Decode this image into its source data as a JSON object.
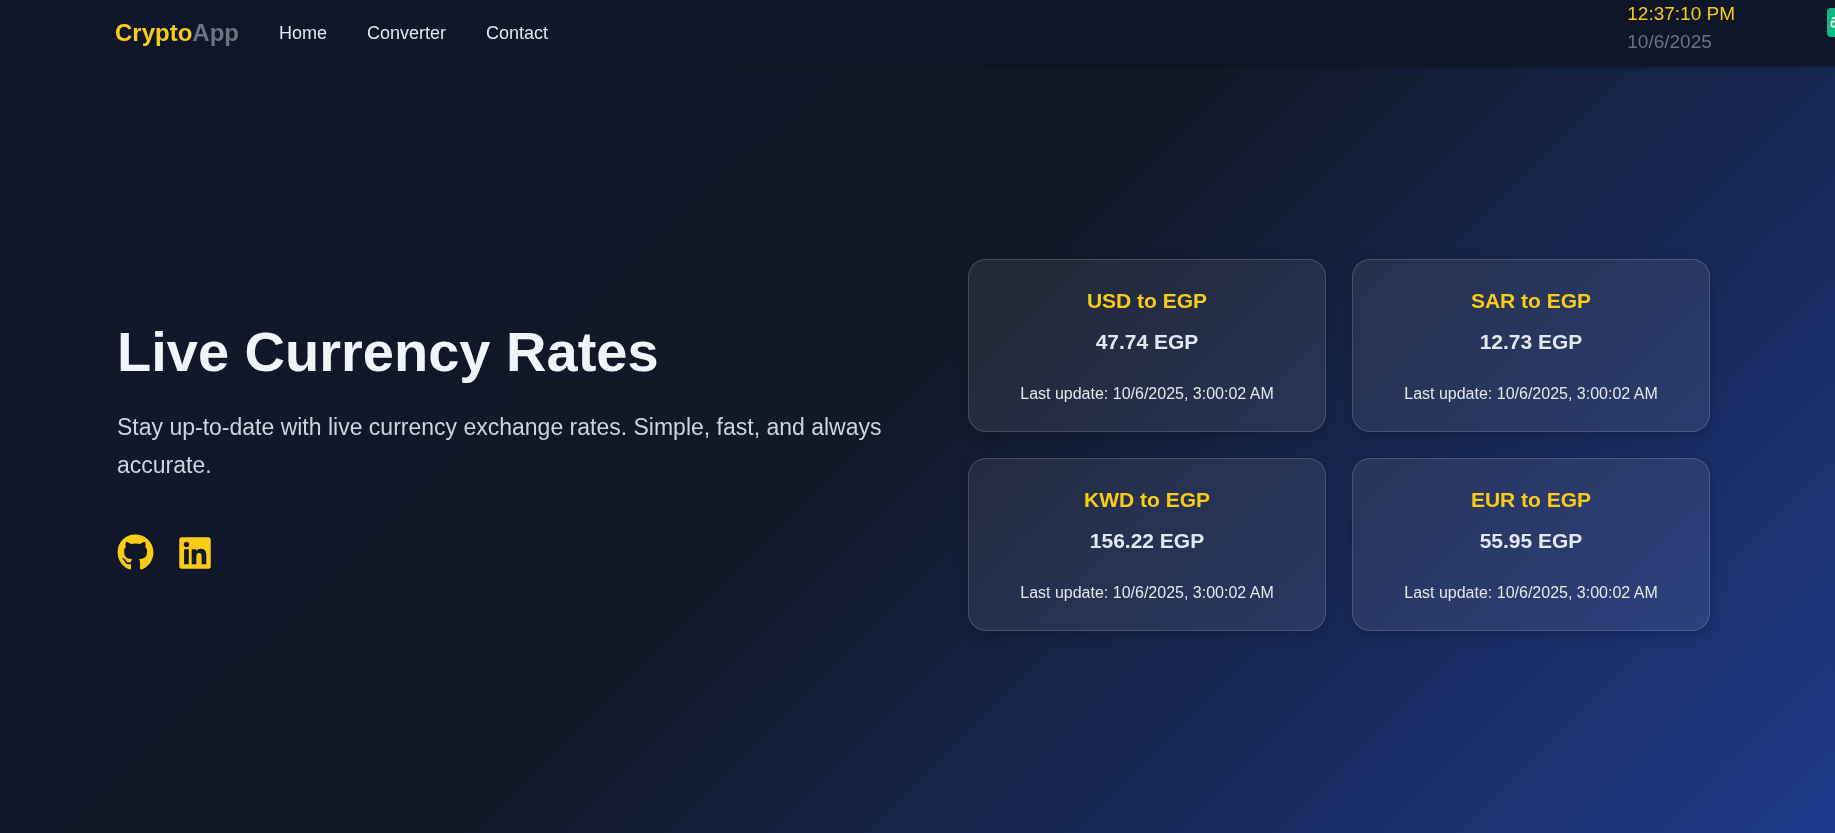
{
  "nav": {
    "brand": {
      "primary": "Crypto",
      "secondary": "App"
    },
    "links": [
      "Home",
      "Converter",
      "Contact"
    ],
    "clock": {
      "time": "12:37:10 PM",
      "date": "10/6/2025"
    }
  },
  "hero": {
    "title": "Live Currency Rates",
    "subtitle": "Stay up-to-date with live currency exchange rates. Simple, fast, and always accurate.",
    "social": [
      {
        "kind": "github"
      },
      {
        "kind": "linkedin"
      }
    ]
  },
  "rates": [
    {
      "pair": "USD to EGP",
      "value": "47.74 EGP",
      "updated": "Last update: 10/6/2025, 3:00:02 AM"
    },
    {
      "pair": "SAR to EGP",
      "value": "12.73 EGP",
      "updated": "Last update: 10/6/2025, 3:00:02 AM"
    },
    {
      "pair": "KWD to EGP",
      "value": "156.22 EGP",
      "updated": "Last update: 10/6/2025, 3:00:02 AM"
    },
    {
      "pair": "EUR to EGP",
      "value": "55.95 EGP",
      "updated": "Last update: 10/6/2025, 3:00:02 AM"
    }
  ]
}
